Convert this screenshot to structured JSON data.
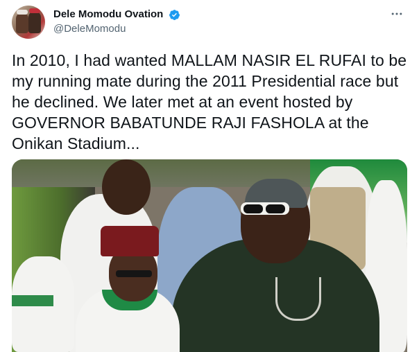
{
  "tweet": {
    "author": {
      "display_name": "Dele Momodu Ovation",
      "handle": "@DeleMomodu",
      "verified": true
    },
    "text": "In 2010, I had wanted MALLAM NASIR EL RUFAI to be my running mate during the 2011 Presidential race but he declined. We later met at an event hosted by GOVERNOR BABATUNDE RAJI FASHOLA at the Onikan Stadium...",
    "more_icon": "more-horizontal-icon"
  },
  "colors": {
    "verified_blue": "#1d9bf0",
    "text_primary": "#0f1419",
    "text_secondary": "#536471"
  }
}
